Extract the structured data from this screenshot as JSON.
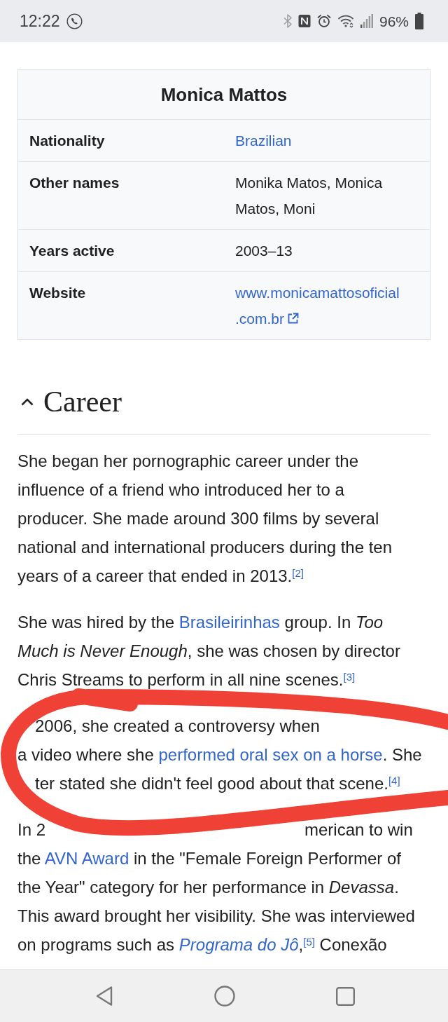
{
  "status_bar": {
    "time": "12:22",
    "battery": "96%"
  },
  "infobox": {
    "title": "Monica Mattos",
    "rows": [
      {
        "label": "Nationality",
        "value_lines": [
          "Brazilian"
        ],
        "link": true,
        "external": false
      },
      {
        "label": "Other names",
        "value_lines": [
          "Monika Matos, Monica",
          "Matos, Moni"
        ],
        "link": false,
        "external": false
      },
      {
        "label": "Years active",
        "value_lines": [
          "2003–13"
        ],
        "link": false,
        "external": false
      },
      {
        "label": "Website",
        "value_lines": [
          "www.monicamattosoficial",
          ".com.br"
        ],
        "link": true,
        "external": true
      }
    ]
  },
  "section": {
    "heading": "Career",
    "expanded": true,
    "paragraphs": [
      {
        "lines": [
          [
            {
              "kind": "text",
              "text": "She began her pornographic career under the"
            }
          ],
          [
            {
              "kind": "text",
              "text": "influence of a friend who introduced her to a"
            }
          ],
          [
            {
              "kind": "text",
              "text": "producer. She made around 300 films by several"
            }
          ],
          [
            {
              "kind": "text",
              "text": "national and international producers during the ten"
            }
          ],
          [
            {
              "kind": "text",
              "text": "years of a career that ended in 2013.$^{[2]}$"
            }
          ]
        ]
      },
      {
        "lines": [
          [
            {
              "kind": "text",
              "text": "She was hired by the "
            },
            {
              "kind": "link",
              "text": "Brasileirinhas",
              "italic": false
            },
            {
              "kind": "text",
              "text": " group. In "
            },
            {
              "kind": "emphasis",
              "text": "Too"
            }
          ],
          [
            {
              "kind": "emphasis",
              "text": "Much is Never Enough"
            },
            {
              "kind": "text",
              "text": ", she was chosen by director"
            }
          ],
          [
            {
              "kind": "text",
              "text": "Chris Streams to perform in all nine scenes.$^{[3]}$"
            }
          ]
        ]
      },
      {
        "lines": [
          [
            {
              "kind": "covered"
            },
            {
              "kind": "text",
              "text": "2006, she created a controversy when"
            }
          ],
          [
            {
              "kind": "text",
              "text": "a video where she "
            },
            {
              "kind": "link",
              "text": "performed oral sex on a horse",
              "italic": false
            },
            {
              "kind": "text",
              "text": ". She"
            }
          ],
          [
            {
              "kind": "covered"
            },
            {
              "kind": "text",
              "text": "ter stated she didn't feel good about that scene.$^{[4]}$"
            }
          ]
        ]
      },
      {
        "lines": [
          [
            {
              "kind": "text",
              "text": "In 2"
            },
            {
              "kind": "covered"
            },
            {
              "kind": "text",
              "text": "merican to win"
            }
          ],
          [
            {
              "kind": "text",
              "text": "the "
            },
            {
              "kind": "link",
              "text": "AVN Award",
              "italic": false
            },
            {
              "kind": "text",
              "text": " in the \"Female Foreign Performer of"
            }
          ],
          [
            {
              "kind": "text",
              "text": "the Year\" category for her performance in "
            },
            {
              "kind": "emphasis",
              "text": "Devassa"
            },
            {
              "kind": "text",
              "text": "."
            }
          ],
          [
            {
              "kind": "text",
              "text": "This award brought her visibility. She was interviewed"
            }
          ],
          [
            {
              "kind": "text",
              "text": "on programs such as "
            },
            {
              "kind": "link",
              "text": "Programa do Jô",
              "italic": true
            },
            {
              "kind": "text",
              "text": ",$^{[5]}$ Conexão"
            }
          ]
        ]
      }
    ]
  },
  "annotations": [
    {
      "kind": "loop"
    }
  ]
}
